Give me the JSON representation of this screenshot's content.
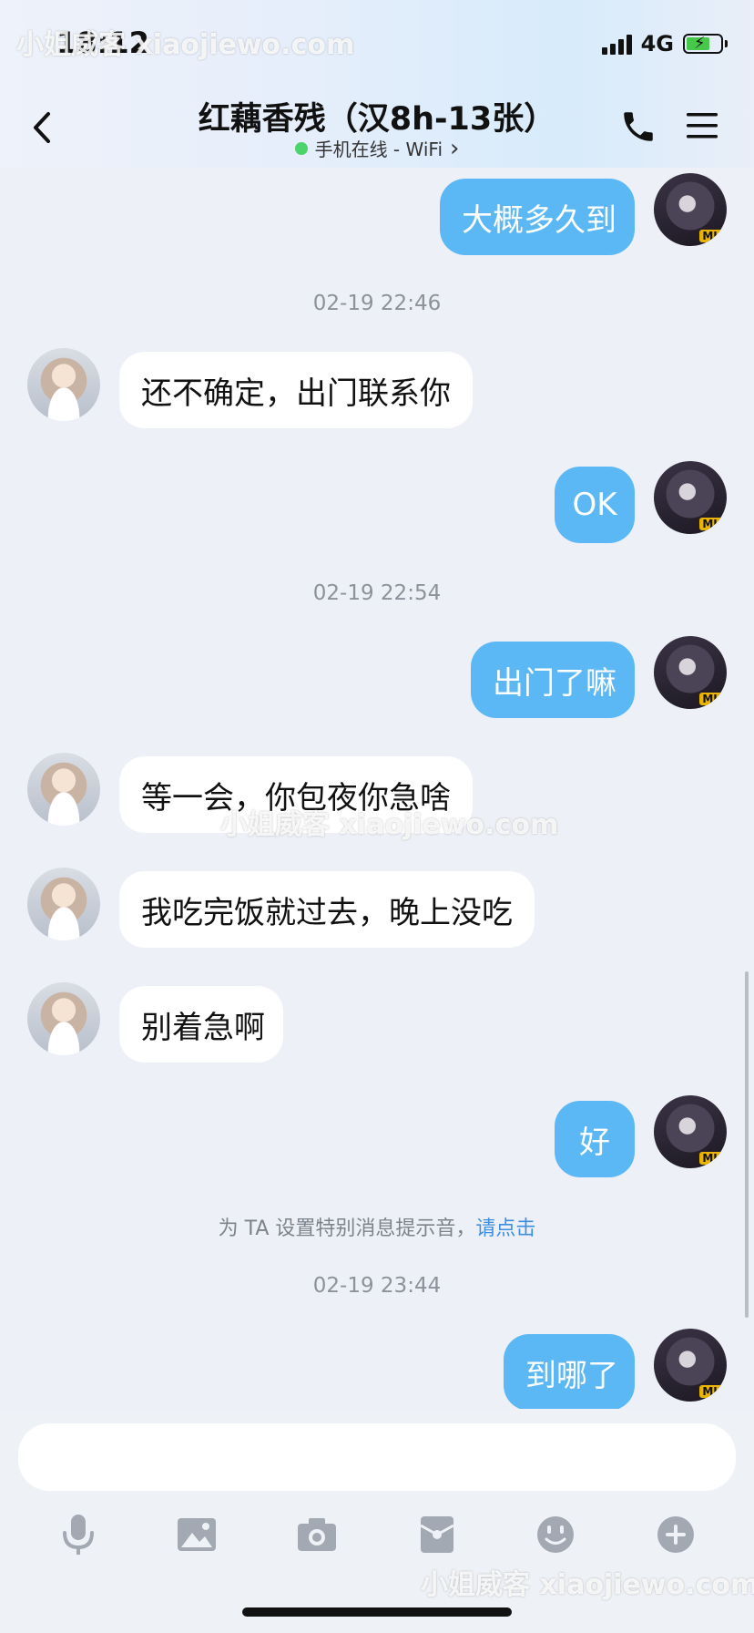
{
  "status_bar": {
    "time": "18:12",
    "network": "4G"
  },
  "header": {
    "back_icon": "chevron-left-icon",
    "title": "红藕香残（汉8h-13张）",
    "subtitle": "手机在线 - WiFi",
    "subtitle_chevron": "›",
    "call_icon": "phone-icon",
    "menu_icon": "hamburger-menu-icon",
    "online_color": "#4cd46a"
  },
  "messages": [
    {
      "id": "m1",
      "from": "me",
      "text": "大概多久到"
    },
    {
      "id": "t1",
      "type": "timestamp",
      "text": "02-19 22:46"
    },
    {
      "id": "m2",
      "from": "her",
      "text": "还不确定，出门联系你"
    },
    {
      "id": "m3",
      "from": "me",
      "text": "OK"
    },
    {
      "id": "t2",
      "type": "timestamp",
      "text": "02-19 22:54"
    },
    {
      "id": "m4",
      "from": "me",
      "text": "出门了嘛"
    },
    {
      "id": "m5",
      "from": "her",
      "text": "等一会，你包夜你急啥"
    },
    {
      "id": "m6",
      "from": "her",
      "text": "我吃完饭就过去，晚上没吃"
    },
    {
      "id": "m7",
      "from": "her",
      "text": "别着急啊"
    },
    {
      "id": "m8",
      "from": "me",
      "text": "好"
    },
    {
      "id": "t3",
      "type": "timestamp",
      "text": "02-19 23:44"
    },
    {
      "id": "m9",
      "from": "me",
      "text": "到哪了"
    }
  ],
  "system_note": {
    "text": "为 TA 设置特别消息提示音，",
    "link": "请点击"
  },
  "avatar_badge": "MU",
  "composer": {
    "input_value": "",
    "tools": [
      "microphone-icon",
      "image-icon",
      "camera-icon",
      "red-packet-icon",
      "emoji-icon",
      "plus-icon"
    ]
  },
  "watermark": "小姐威客 xiaojiewo.com",
  "colors": {
    "outgoing_bubble": "#5cb8f5",
    "incoming_bubble": "#ffffff",
    "background": "#edf0f6",
    "link": "#3f8fe0"
  }
}
